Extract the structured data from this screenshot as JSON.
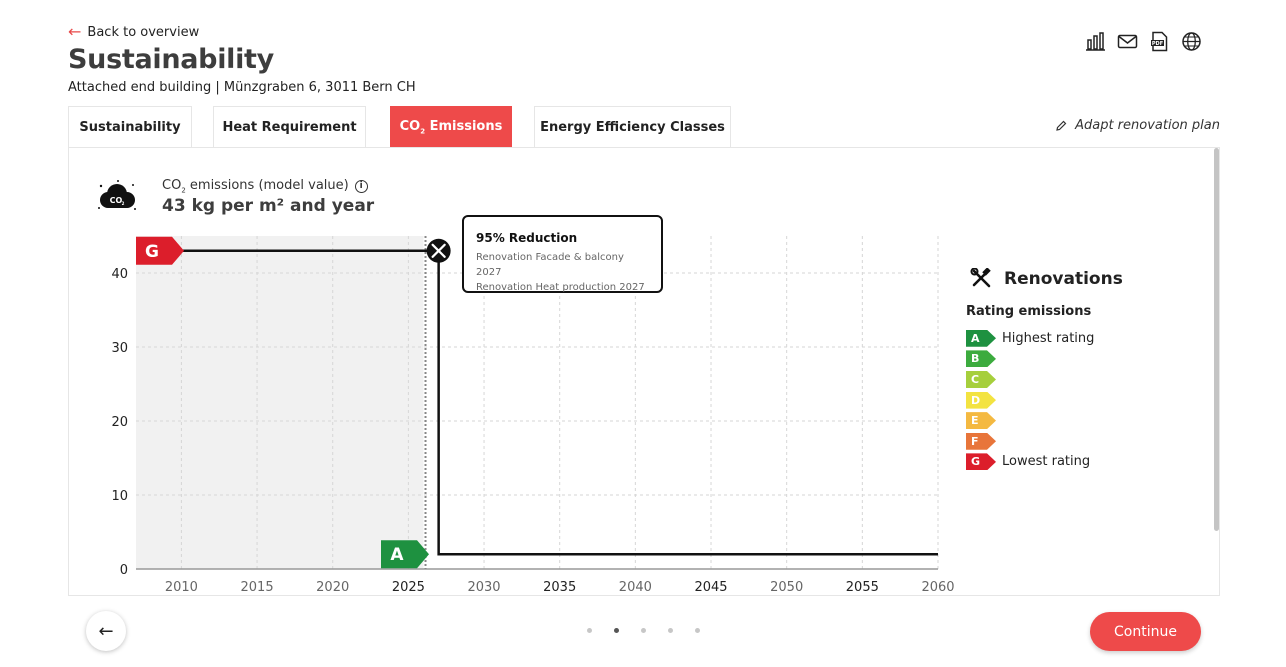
{
  "header": {
    "back_label": "Back to overview",
    "title": "Sustainability",
    "address": "Attached end building | Münzgraben 6, 3011 Bern CH"
  },
  "toolbar_icons": [
    "bar-chart-icon",
    "mail-icon",
    "pdf-icon",
    "globe-icon"
  ],
  "tabs": [
    {
      "label": "Sustainability",
      "active": false
    },
    {
      "label": "Heat Requirement",
      "active": false
    },
    {
      "label_main": "CO",
      "label_sub": "2",
      "label_rest": " Emissions",
      "active": true
    },
    {
      "label": "Energy Efficiency Classes",
      "active": false
    }
  ],
  "adapt_label": "Adapt renovation plan",
  "metric": {
    "label_main": "CO",
    "label_sub": "2",
    "label_rest": " emissions (model value)",
    "value": "43 kg per m² and year",
    "badge_text": "CO",
    "badge_sub": "2"
  },
  "tooltip": {
    "title": "95% Reduction",
    "lines": [
      "Renovation Facade & balcony 2027",
      "Renovation Heat production 2027"
    ]
  },
  "legend": {
    "title": "Renovations",
    "subtitle": "Rating emissions",
    "items": [
      {
        "letter": "A",
        "color": "#1e9140",
        "text": "Highest rating"
      },
      {
        "letter": "B",
        "color": "#3cab3e",
        "text": ""
      },
      {
        "letter": "C",
        "color": "#a6cf3c",
        "text": ""
      },
      {
        "letter": "D",
        "color": "#f3e341",
        "text": ""
      },
      {
        "letter": "E",
        "color": "#f4b941",
        "text": ""
      },
      {
        "letter": "F",
        "color": "#e8753a",
        "text": ""
      },
      {
        "letter": "G",
        "color": "#dc1e2b",
        "text": "Lowest rating"
      }
    ]
  },
  "chart_data": {
    "type": "line",
    "xlim": [
      2007,
      2060
    ],
    "ylim": [
      0,
      45
    ],
    "x_ticks": [
      2010,
      2015,
      2020,
      2025,
      2030,
      2035,
      2040,
      2045,
      2050,
      2055,
      2060
    ],
    "x_tick_labels": [
      "2010",
      "2015",
      "2020",
      "2025",
      "2030",
      "2035",
      "2040",
      "2045",
      "2050",
      "2055",
      "2060"
    ],
    "y_ticks": [
      0,
      10,
      20,
      30,
      40
    ],
    "y_tick_labels": [
      "0",
      "10",
      "20",
      "30",
      "40"
    ],
    "series": [
      {
        "x": [
          2007,
          2027,
          2027,
          2060
        ],
        "y": [
          43,
          43,
          2,
          2
        ],
        "color": "#111111"
      }
    ],
    "past_shading_until": 2026,
    "current_marker_x": 2026,
    "renovation_marker": {
      "x": 2027,
      "y": 43
    },
    "start_rating": {
      "letter": "G",
      "y": 43,
      "color": "#dc1e2b"
    },
    "end_rating": {
      "letter": "A",
      "y": 2,
      "color": "#1e9140"
    },
    "grid": true
  },
  "footer": {
    "continue_label": "Continue",
    "dots": 5,
    "active_dot": 1
  }
}
